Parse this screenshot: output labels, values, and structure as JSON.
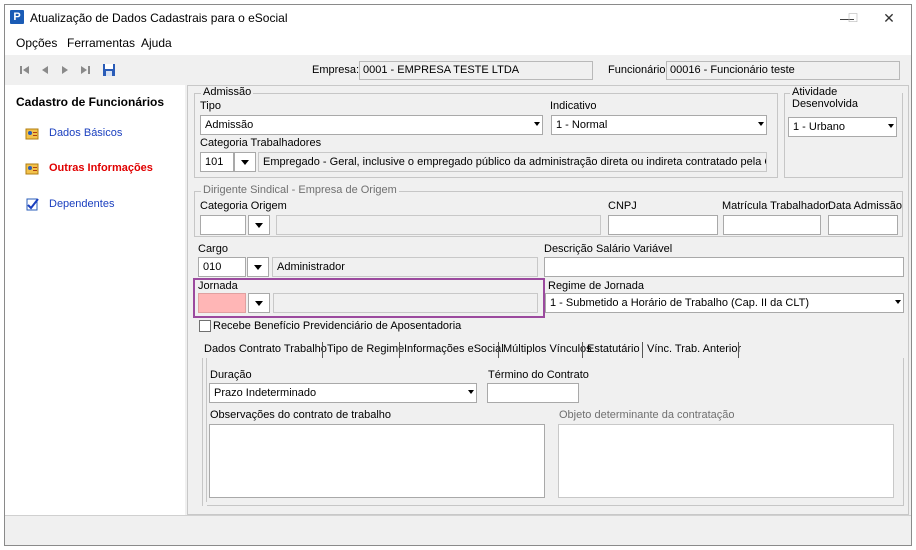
{
  "window": {
    "title": "Atualização de Dados Cadastrais para o eSocial",
    "app_icon": "P",
    "controls": {
      "minimize": "—",
      "maximize": "☐",
      "close": "✕"
    }
  },
  "menu": [
    "Opções",
    "Ferramentas",
    "Ajuda"
  ],
  "toolbar": {
    "empresa_label": "Empresa:",
    "empresa_value": "0001 - EMPRESA TESTE LTDA",
    "funcionario_label": "Funcionário:",
    "funcionario_value": "00016 - Funcionário teste",
    "nav_icons": [
      "first-record-icon",
      "prev-record-icon",
      "next-record-icon",
      "last-record-icon",
      "save-icon"
    ]
  },
  "sidebar": {
    "title": "Cadastro de Funcionários",
    "items": [
      {
        "label": "Dados Básicos",
        "icon": "person-card-icon",
        "active": false
      },
      {
        "label": "Outras Informações",
        "icon": "person-card-icon",
        "active": true
      },
      {
        "label": "Dependentes",
        "icon": "checklist-icon",
        "active": false
      }
    ]
  },
  "admissao": {
    "group_title": "Admissão",
    "tipo_label": "Tipo",
    "tipo_value": "Admissão",
    "indicativo_label": "Indicativo",
    "indicativo_value": "1 - Normal",
    "categoria_label": "Categoria Trabalhadores",
    "categoria_code": "101",
    "categoria_desc": "Empregado - Geral, inclusive o empregado público da administração direta ou indireta contratado pela CLT"
  },
  "atividade": {
    "group_title": "Atividade Desenvolvida",
    "value": "1 - Urbano"
  },
  "dirigente": {
    "group_title": "Dirigente Sindical - Empresa de Origem",
    "categoria_origem_label": "Categoria Origem",
    "cnpj_label": "CNPJ",
    "matricula_label": "Matrícula Trabalhador",
    "data_admissao_label": "Data Admissão"
  },
  "cargo": {
    "label": "Cargo",
    "code": "010",
    "desc": "Administrador"
  },
  "descricao_salario": {
    "label": "Descrição Salário Variável",
    "value": ""
  },
  "jornada": {
    "label": "Jornada",
    "code": "",
    "desc": "",
    "highlight_color": "#9b4a9e",
    "field_color": "#ffb6b6"
  },
  "regime_jornada": {
    "label": "Regime de Jornada",
    "value": "1 - Submetido a Horário de Trabalho (Cap. II da CLT)"
  },
  "beneficio": {
    "label": "Recebe Benefício Previdenciário de Aposentadoria",
    "checked": false
  },
  "tabs": [
    "Dados Contrato Trabalho",
    "Tipo de Regime",
    "Informações eSocial",
    "Múltiplos Vínculos",
    "Estatutário",
    "Vínc. Trab. Anterior"
  ],
  "contrato": {
    "duracao_label": "Duração",
    "duracao_value": "Prazo Indeterminado",
    "termino_label": "Término do Contrato",
    "termino_value": "",
    "observacoes_label": "Observações do contrato de trabalho",
    "objeto_label": "Objeto determinante da contratação"
  }
}
